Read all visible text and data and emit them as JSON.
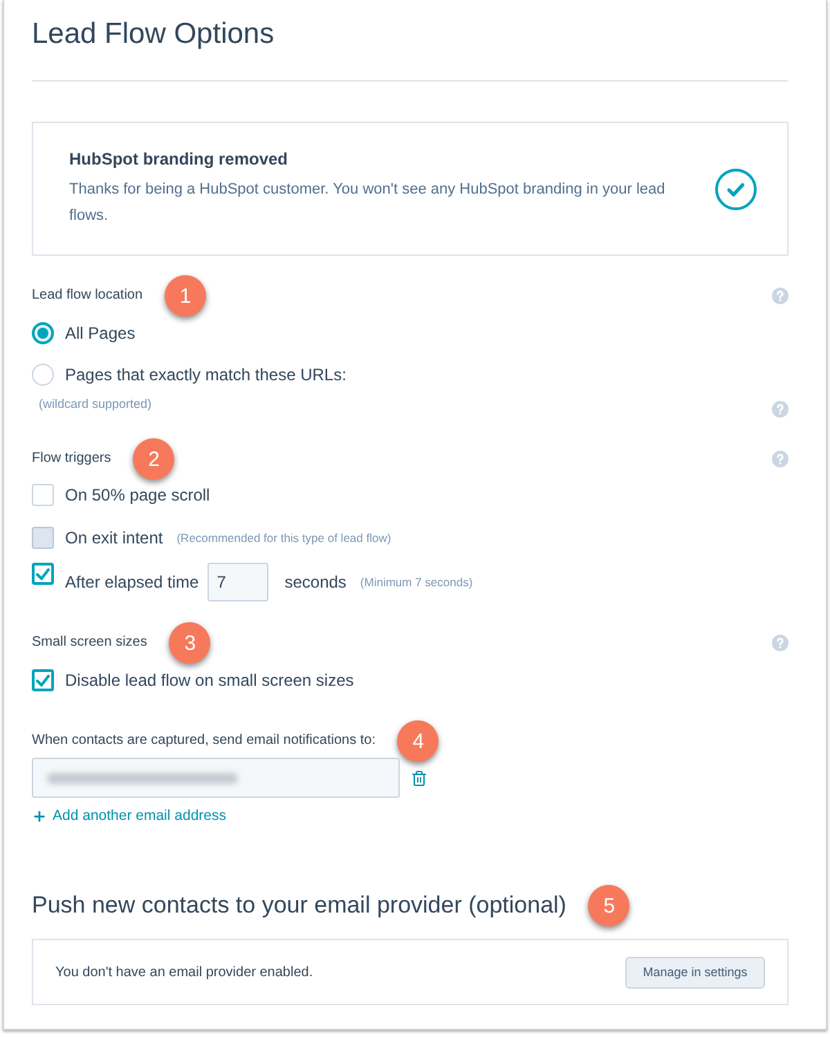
{
  "title": "Lead Flow Options",
  "notice": {
    "title": "HubSpot branding removed",
    "text": "Thanks for being a HubSpot customer. You won't see any HubSpot branding in your lead flows."
  },
  "location": {
    "label": "Lead flow location",
    "callout": "1",
    "options": [
      {
        "label": "All Pages",
        "selected": true
      },
      {
        "label": "Pages that exactly match these URLs:",
        "selected": false
      }
    ],
    "hint": "(wildcard supported)"
  },
  "triggers": {
    "label": "Flow triggers",
    "callout": "2",
    "items": [
      {
        "kind": "checkbox",
        "label": "On 50% page scroll",
        "checked": false,
        "disabled": false
      },
      {
        "kind": "checkbox",
        "label": "On exit intent",
        "note": "(Recommended for this type of lead flow)",
        "checked": false,
        "disabled": true
      },
      {
        "kind": "timer",
        "label": "After elapsed time",
        "value": "7",
        "unit": "seconds",
        "note": "(Minimum 7 seconds)",
        "checked": true,
        "disabled": false
      }
    ]
  },
  "small_screens": {
    "label": "Small screen sizes",
    "callout": "3",
    "option": {
      "label": "Disable lead flow on small screen sizes",
      "checked": true
    }
  },
  "notifications": {
    "label": "When contacts are captured, send email notifications to:",
    "callout": "4",
    "email_fields": [
      {
        "redacted": true
      }
    ],
    "add_link": "Add another email address"
  },
  "provider": {
    "heading": "Push new contacts to your email provider (optional)",
    "callout": "5",
    "message": "You don't have an email provider enabled.",
    "button": "Manage in settings"
  }
}
